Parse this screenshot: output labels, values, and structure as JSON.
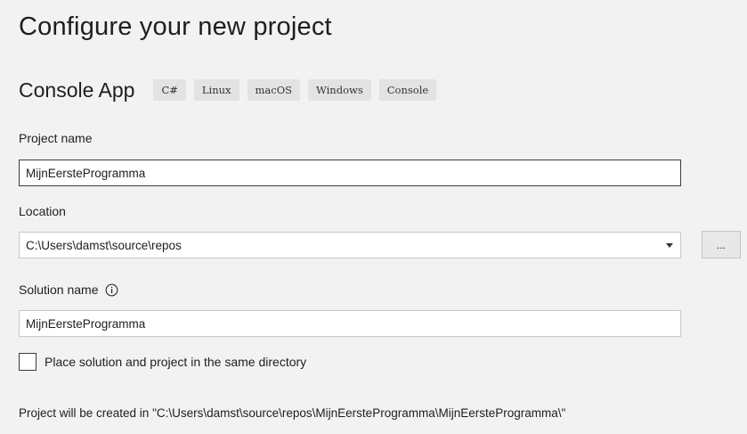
{
  "page": {
    "title": "Configure your new project"
  },
  "template": {
    "name": "Console App",
    "tags": [
      "C#",
      "Linux",
      "macOS",
      "Windows",
      "Console"
    ]
  },
  "project_name": {
    "label": "Project name",
    "value": "MijnEersteProgramma"
  },
  "location": {
    "label": "Location",
    "value": "C:\\Users\\damst\\source\\repos",
    "browse_label": "..."
  },
  "solution_name": {
    "label": "Solution name",
    "value": "MijnEersteProgramma"
  },
  "same_directory": {
    "label": "Place solution and project in the same directory",
    "checked": false
  },
  "footer": {
    "created_path": "Project will be created in \"C:\\Users\\damst\\source\\repos\\MijnEersteProgramma\\MijnEersteProgramma\\\""
  },
  "icons": {
    "info": "info-circle-icon",
    "dropdown": "chevron-down-icon"
  },
  "colors": {
    "background": "#f2f2f2",
    "tag_background": "#e3e3e3",
    "input_border_focused": "#3c3c3c",
    "input_border": "#c8c8c8"
  }
}
